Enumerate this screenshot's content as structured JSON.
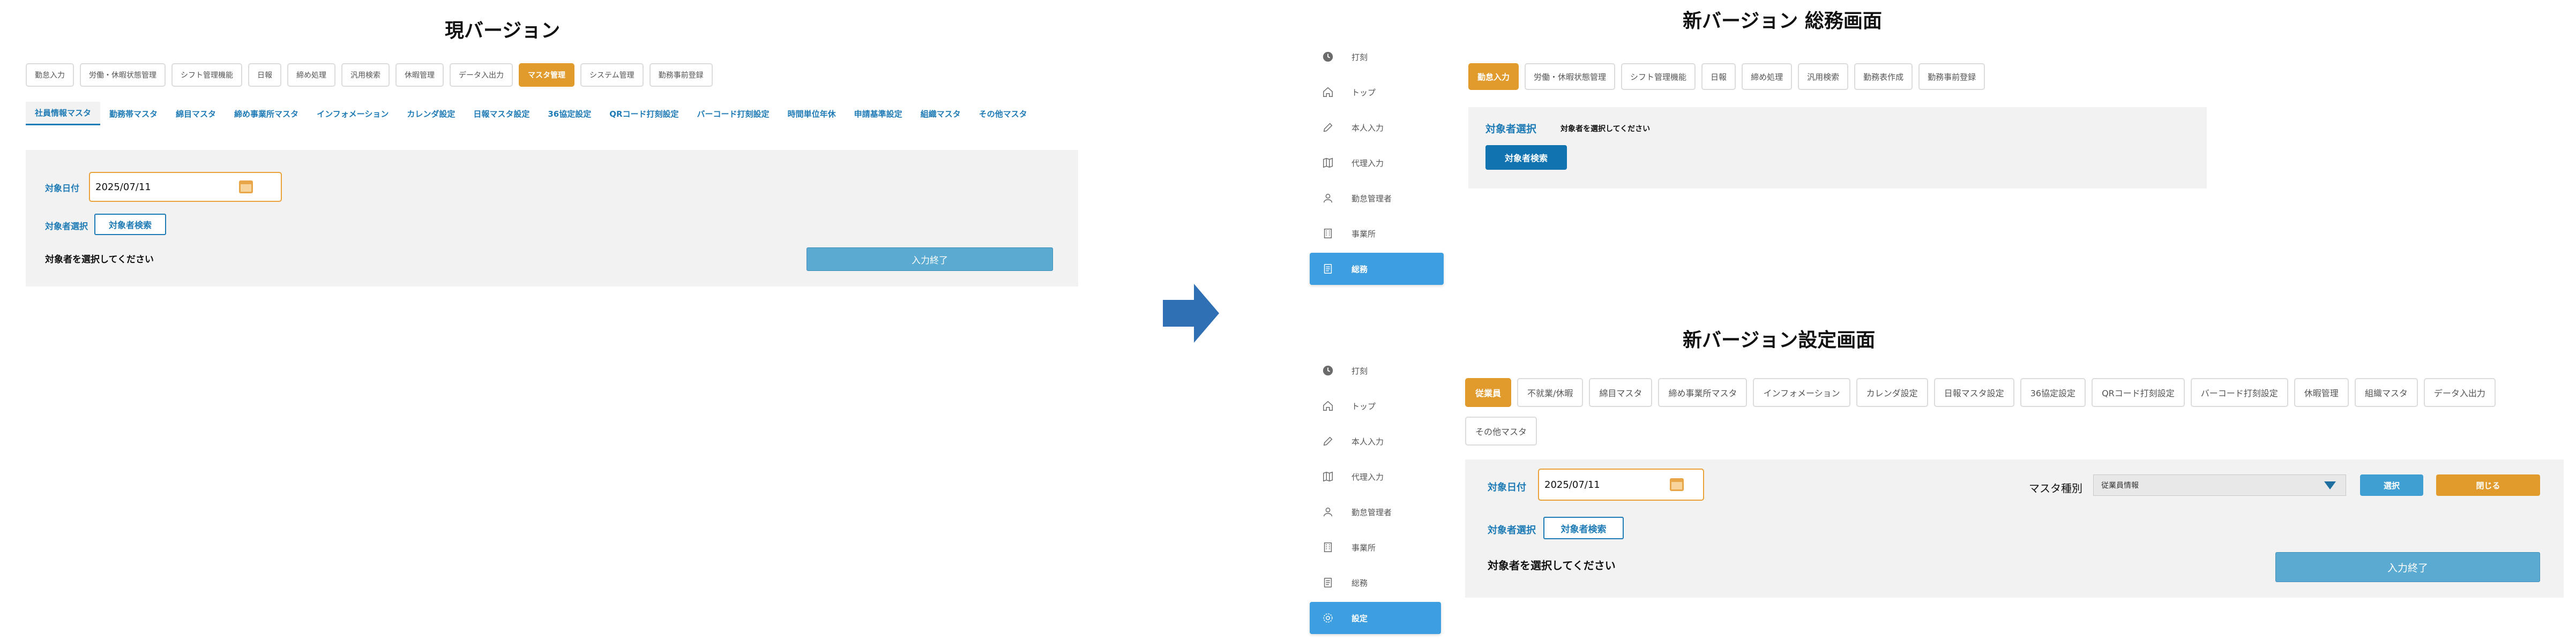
{
  "old_version": {
    "title": "現バージョン",
    "main_tabs": [
      {
        "label": "勤怠入力",
        "active": false
      },
      {
        "label": "労働・休暇状態管理",
        "active": false
      },
      {
        "label": "シフト管理機能",
        "active": false
      },
      {
        "label": "日報",
        "active": false
      },
      {
        "label": "締め処理",
        "active": false
      },
      {
        "label": "汎用検索",
        "active": false
      },
      {
        "label": "休暇管理",
        "active": false
      },
      {
        "label": "データ入出力",
        "active": false
      },
      {
        "label": "マスタ管理",
        "active": true
      },
      {
        "label": "システム管理",
        "active": false
      },
      {
        "label": "勤務事前登録",
        "active": false
      }
    ],
    "sub_tabs": [
      {
        "label": "社員情報マスタ",
        "active": true
      },
      {
        "label": "勤務帯マスタ",
        "active": false
      },
      {
        "label": "綿目マスタ",
        "active": false
      },
      {
        "label": "締め事業所マスタ",
        "active": false
      },
      {
        "label": "インフォメーション",
        "active": false
      },
      {
        "label": "カレンダ設定",
        "active": false
      },
      {
        "label": "日報マスタ設定",
        "active": false
      },
      {
        "label": "36協定設定",
        "active": false
      },
      {
        "label": "QRコード打刻設定",
        "active": false
      },
      {
        "label": "バーコード打刻設定",
        "active": false
      },
      {
        "label": "時間単位年休",
        "active": false
      },
      {
        "label": "申請基準設定",
        "active": false
      },
      {
        "label": "組織マスタ",
        "active": false
      },
      {
        "label": "その他マスタ",
        "active": false
      }
    ],
    "target_date_label": "対象日付",
    "target_date_value": "2025/07/11",
    "target_select_label": "対象者選択",
    "search_button": "対象者検索",
    "message": "対象者を選択してください",
    "finish_button": "入力終了"
  },
  "sidebar": {
    "items": [
      {
        "label": "打刻",
        "icon": "clock-icon"
      },
      {
        "label": "トップ",
        "icon": "home-icon"
      },
      {
        "label": "本人入力",
        "icon": "pencil-icon"
      },
      {
        "label": "代理入力",
        "icon": "map-icon"
      },
      {
        "label": "勤怠管理者",
        "icon": "person-icon"
      },
      {
        "label": "事業所",
        "icon": "building-icon"
      },
      {
        "label": "総務",
        "icon": "document-icon"
      },
      {
        "label": "設定",
        "icon": "gear-icon"
      }
    ]
  },
  "new_general": {
    "title": "新バージョン 総務画面",
    "main_tabs": [
      {
        "label": "勤怠入力",
        "active": true
      },
      {
        "label": "労働・休暇状態管理",
        "active": false
      },
      {
        "label": "シフト管理機能",
        "active": false
      },
      {
        "label": "日報",
        "active": false
      },
      {
        "label": "締め処理",
        "active": false
      },
      {
        "label": "汎用検索",
        "active": false
      },
      {
        "label": "勤務表作成",
        "active": false
      },
      {
        "label": "勤務事前登録",
        "active": false
      }
    ],
    "target_select_label": "対象者選択",
    "message": "対象者を選択してください",
    "search_button": "対象者検索"
  },
  "new_settings": {
    "title": "新バージョン設定画面",
    "tabs": [
      {
        "label": "従業員",
        "active": true
      },
      {
        "label": "不就業/休暇",
        "active": false
      },
      {
        "label": "綿目マスタ",
        "active": false
      },
      {
        "label": "締め事業所マスタ",
        "active": false
      },
      {
        "label": "インフォメーション",
        "active": false
      },
      {
        "label": "カレンダ設定",
        "active": false
      },
      {
        "label": "日報マスタ設定",
        "active": false
      },
      {
        "label": "36協定設定",
        "active": false
      },
      {
        "label": "QRコード打刻設定",
        "active": false
      },
      {
        "label": "バーコード打刻設定",
        "active": false
      },
      {
        "label": "休暇管理",
        "active": false
      },
      {
        "label": "組織マスタ",
        "active": false
      },
      {
        "label": "データ入出力",
        "active": false
      },
      {
        "label": "その他マスタ",
        "active": false
      }
    ],
    "target_date_label": "対象日付",
    "target_date_value": "2025/07/11",
    "master_type_label": "マスタ種別",
    "master_type_value": "従業員情報",
    "select_button": "選択",
    "close_button": "閉じる",
    "target_select_label": "対象者選択",
    "search_button": "対象者検索",
    "message": "対象者を選択してください",
    "finish_button": "入力終了"
  },
  "colors": {
    "accent_orange": "#e19a2c",
    "accent_blue": "#1f7bb5",
    "sidebar_active": "#3d9ee0",
    "finish_button": "#5aaad2",
    "panel_bg": "#f2f2f2"
  }
}
